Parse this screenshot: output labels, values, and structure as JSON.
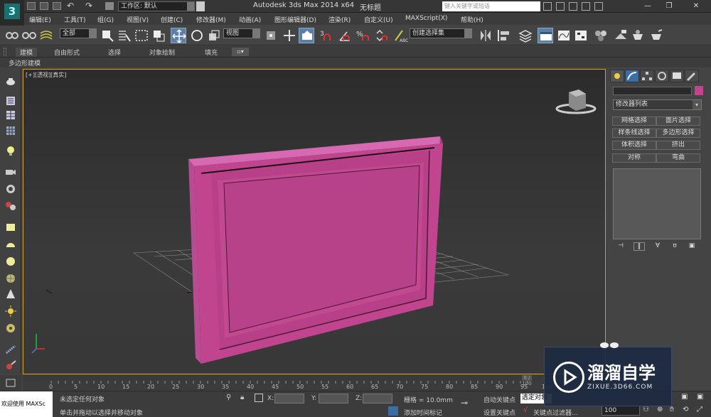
{
  "titlebar": {
    "workspace": "工作区: 默认",
    "app_title": "Autodesk 3ds Max  2014 x64",
    "doc": "无标题",
    "search_placeholder": "键入关键字或短语",
    "minimize": "—",
    "restore": "❐",
    "close": "✕"
  },
  "menus": [
    "编辑(E)",
    "工具(T)",
    "组(G)",
    "视图(V)",
    "创建(C)",
    "修改器(M)",
    "动画(A)",
    "图形编辑器(D)",
    "渲染(R)",
    "自定义(U)",
    "MAXScript(X)",
    "帮助(H)"
  ],
  "toolbar": {
    "selection_filter": "全部",
    "ref_coord": "视图",
    "named_selection": "创建选择集",
    "snap_angle": "3",
    "snap_percent": "%"
  },
  "ribbon": {
    "tabs": [
      "建模",
      "自由形式",
      "选择",
      "对象绘制",
      "填充"
    ],
    "sub": "多边形建模"
  },
  "viewport": {
    "label": "[+][透视][真实]"
  },
  "command_panel": {
    "modifier_list": "修改器列表",
    "buttons": [
      "网格选择",
      "面片选择",
      "样条线选择",
      "多边形选择",
      "体积选择",
      "挤出",
      "对称",
      "弯曲"
    ]
  },
  "timeline": {
    "slider": "0 / 100",
    "ticks": [
      "0",
      "5",
      "10",
      "15",
      "20",
      "25",
      "30",
      "35",
      "40",
      "45",
      "50",
      "55",
      "60",
      "65",
      "70",
      "75",
      "80",
      "85",
      "90",
      "95",
      "100"
    ]
  },
  "status": {
    "maxscript": "欢迎使用 MAXSc",
    "line1": "未选定任何对象",
    "line2": "单击并拖动以选择并移动对象",
    "x": "X:",
    "y": "Y:",
    "z": "Z:",
    "grid": "栅格 = 10.0mm",
    "add_tag": "添加时间标记",
    "autokey": "自动关键点",
    "setkey": "设置关键点",
    "keymode": "选定对象",
    "keyfilter": "关键点过滤器...",
    "frame": "100"
  },
  "watermark": {
    "cn": "溜溜自学",
    "en": "ZIXUE.3D66.COM"
  },
  "colors": {
    "object": "#c0448e",
    "accent": "#1a6f6f",
    "viewport_border": "#d0a020"
  }
}
